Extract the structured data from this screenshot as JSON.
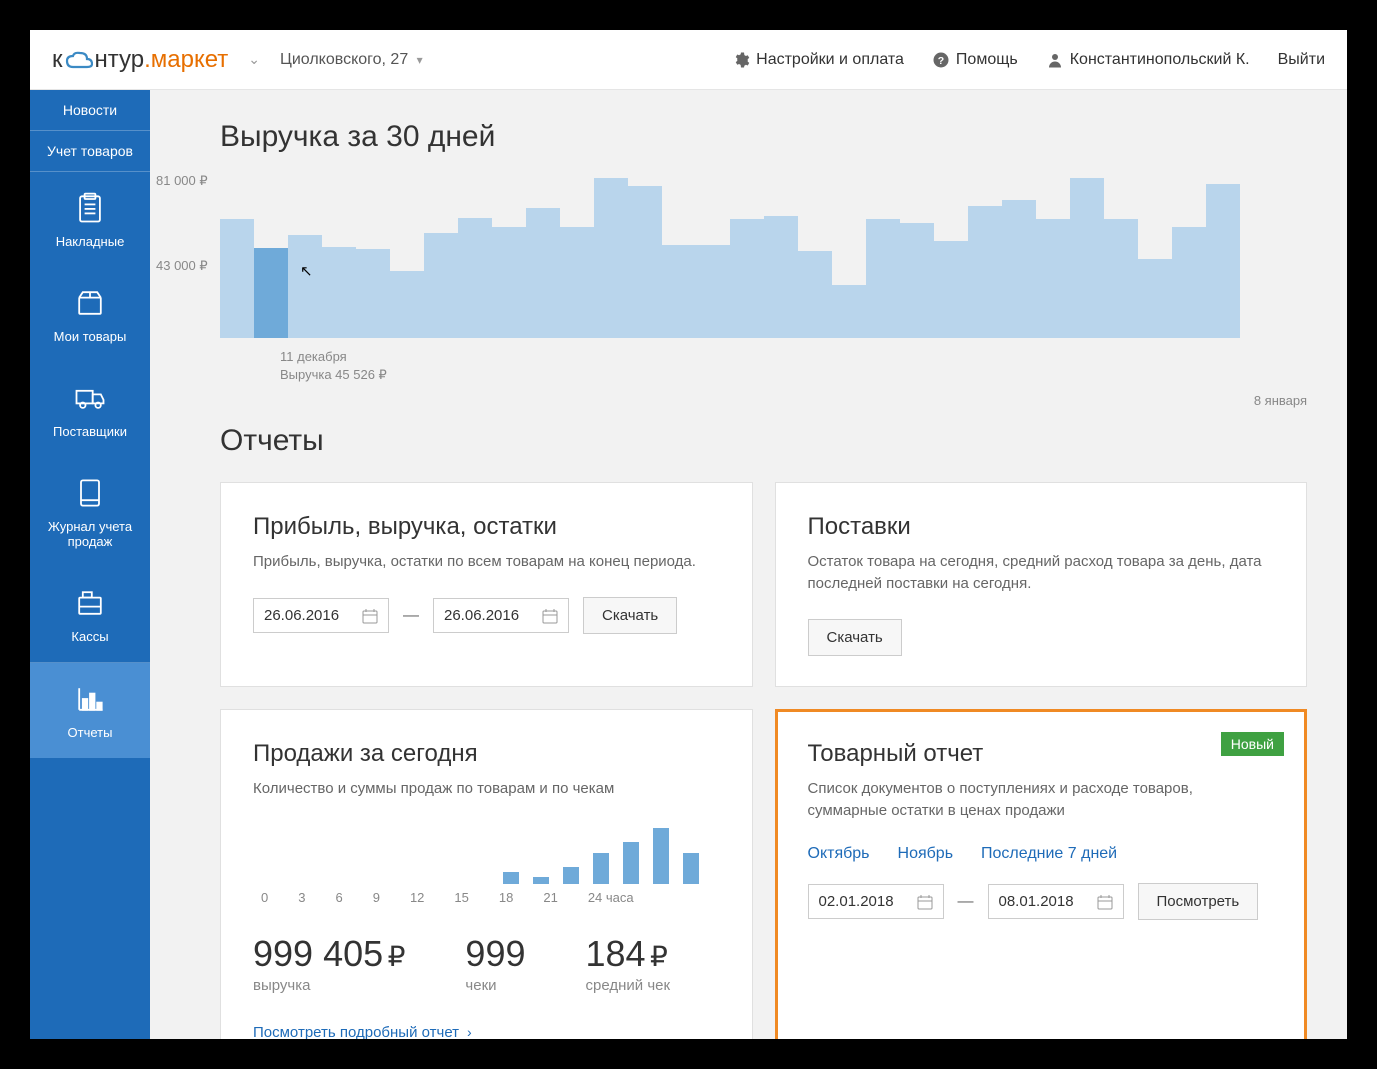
{
  "header": {
    "brand_prefix": "к",
    "brand_middle": "нтур",
    "brand_dot": ".",
    "brand_suffix": "маркет",
    "location": "Циолковского, 27",
    "settings": "Настройки и оплата",
    "help": "Помощь",
    "user": "Константинопольский К.",
    "logout": "Выйти"
  },
  "sidebar": {
    "news": "Новости",
    "goods_account": "Учет товаров",
    "invoices": "Накладные",
    "my_goods": "Мои товары",
    "suppliers": "Поставщики",
    "sales_journal": "Журнал учета продаж",
    "cashboxes": "Кассы",
    "reports": "Отчеты"
  },
  "revenue": {
    "title": "Выручка за 30 дней",
    "y_top": "81 000 ₽",
    "y_mid": "43 000 ₽",
    "tooltip_line1": "11 декабря",
    "tooltip_line2": "Выручка 45 526 ₽",
    "x_right": "8 января"
  },
  "chart_data": {
    "type": "bar",
    "title": "Выручка за 30 дней",
    "ylabel": "₽",
    "ylim": [
      0,
      81000
    ],
    "y_ticks": [
      43000,
      81000
    ],
    "highlighted_index": 1,
    "highlighted_label": "11 декабря",
    "highlighted_value": 45526,
    "x_end_label": "8 января",
    "values": [
      60000,
      45526,
      52000,
      46000,
      45000,
      34000,
      53000,
      61000,
      56000,
      66000,
      56000,
      81000,
      77000,
      47000,
      47000,
      60000,
      62000,
      44000,
      27000,
      60000,
      58000,
      49000,
      67000,
      70000,
      60000,
      81000,
      60000,
      40000,
      56000,
      78000
    ]
  },
  "reports_title": "Отчеты",
  "card_profit": {
    "title": "Прибыль, выручка, остатки",
    "desc": "Прибыль, выручка, остатки по всем товарам на конец периода.",
    "date_from": "26.06.2016",
    "date_to": "26.06.2016",
    "download": "Скачать"
  },
  "card_supplies": {
    "title": "Поставки",
    "desc": "Остаток товара на сегодня, средний расход товара за день, дата последней поставки на сегодня.",
    "download": "Скачать"
  },
  "card_sales": {
    "title": "Продажи за сегодня",
    "desc": "Количество и суммы продаж по товарам и по чекам",
    "hours": [
      "0",
      "3",
      "6",
      "9",
      "12",
      "15",
      "18",
      "21",
      "24 часа"
    ],
    "revenue_val": "999 405",
    "revenue_lab": "выручка",
    "checks_val": "999",
    "checks_lab": "чеки",
    "avg_val": "184",
    "avg_lab": "средний чек",
    "detail_link": "Посмотреть подробный отчет",
    "hourly_chart": {
      "type": "bar",
      "xlabel": "часа",
      "x_ticks": [
        0,
        3,
        6,
        9,
        12,
        15,
        18,
        21,
        24
      ],
      "values": [
        0,
        0,
        0,
        0,
        0,
        0,
        0,
        0,
        8,
        5,
        12,
        22,
        30,
        40,
        22
      ]
    }
  },
  "card_goods": {
    "title": "Товарный отчет",
    "badge": "Новый",
    "desc": "Список документов о поступлениях и расходе товаров, суммарные остатки в ценах продажи",
    "quick1": "Октябрь",
    "quick2": "Ноябрь",
    "quick3": "Последние 7 дней",
    "date_from": "02.01.2018",
    "date_to": "08.01.2018",
    "view": "Посмотреть"
  },
  "ruble": "₽"
}
